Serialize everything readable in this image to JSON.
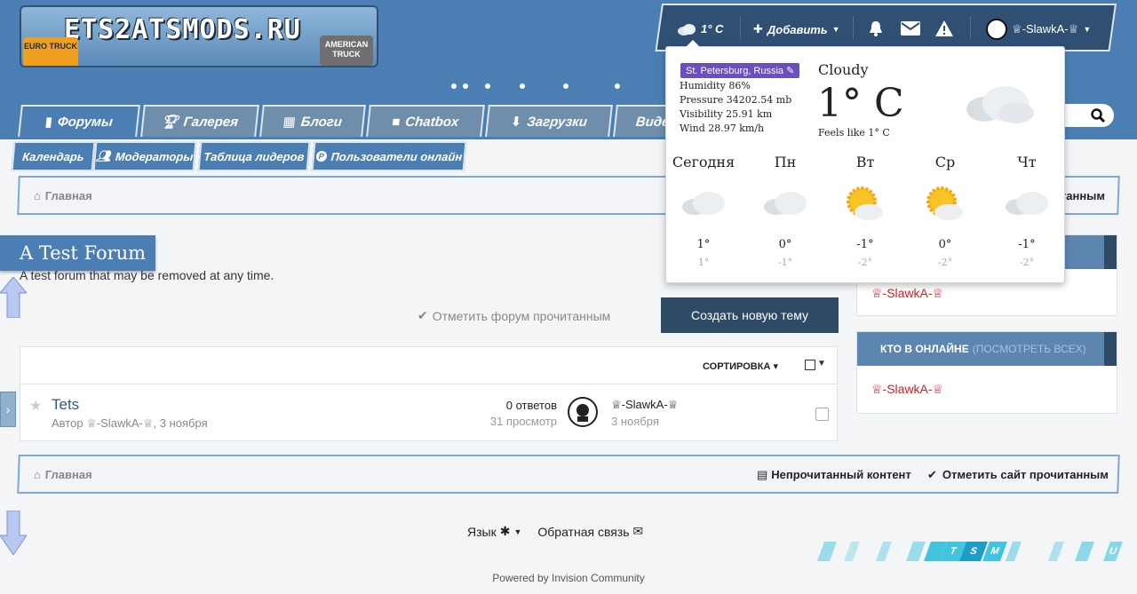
{
  "site": {
    "logo_text": "ETS2ATSMODS.RU",
    "logo_left_badge": "EURO TRUCK",
    "logo_right_badge": "AMERICAN TRUCK"
  },
  "userbar": {
    "weather_temp": "1° C",
    "add_label": "Добавить",
    "username": "♕-SlawkA-♕"
  },
  "nav": {
    "tabs": [
      {
        "label": "Форумы",
        "icon": "book-icon"
      },
      {
        "label": "Галерея",
        "icon": "trophy-icon"
      },
      {
        "label": "Блоги",
        "icon": "calendar-icon"
      },
      {
        "label": "Chatbox",
        "icon": "video-icon"
      },
      {
        "label": "Загрузки",
        "icon": "download-icon"
      },
      {
        "label": "Виде",
        "icon": ""
      }
    ],
    "subtabs": [
      {
        "label": "Календарь"
      },
      {
        "label": "Модераторы",
        "icon": "users-icon"
      },
      {
        "label": "Таблица лидеров"
      },
      {
        "label": "Пользователи онлайн",
        "icon": "online-icon"
      }
    ]
  },
  "breadcrumb": {
    "home": "Главная",
    "right_text": "танным"
  },
  "forum": {
    "title": "A Test Forum",
    "description": "A test forum that may be removed at any time.",
    "mark_read": "Отметить форум прочитанным",
    "new_topic": "Создать новую тему",
    "sort_label": "СОРТИРОВКА"
  },
  "topics": [
    {
      "title": "Tets",
      "author_prefix": "Автор",
      "author": "♕-SlawkA-♕",
      "date": "3 ноября",
      "replies": "0 ответов",
      "views": "31 просмотр",
      "last_user": "♕-SlawkA-♕",
      "last_date": "3 ноября"
    }
  ],
  "sidebar": {
    "box1_user": "♕-SlawkA-♕",
    "online_title": "КТО В ОНЛАЙНЕ",
    "online_link": "(ПОСМОТРЕТЬ ВСЕХ)",
    "online_user": "♕-SlawkA-♕"
  },
  "breadcrumb_bottom": {
    "home": "Главная",
    "unread": "Непрочитанный контент",
    "mark_site": "Отметить сайт прочитанным"
  },
  "footer": {
    "language": "Язык",
    "feedback": "Обратная связь",
    "powered": "Powered by Invision Community"
  },
  "decor": {
    "strip_letters": [
      "T",
      "S",
      "M",
      "U"
    ]
  },
  "weather": {
    "location": "St. Petersburg, Russia",
    "humidity": "Humidity 86%",
    "pressure": "Pressure 34202.54 mb",
    "visibility": "Visibility 25.91 km",
    "wind": "Wind 28.97 km/h",
    "condition": "Cloudy",
    "temp": "1° C",
    "feels": "Feels like 1° C",
    "days": [
      {
        "name": "Сегодня",
        "hi": "1°",
        "lo": "1°",
        "icon": "cloud-icon"
      },
      {
        "name": "Пн",
        "hi": "0°",
        "lo": "-1°",
        "icon": "cloud-icon"
      },
      {
        "name": "Вт",
        "hi": "-1°",
        "lo": "-2°",
        "icon": "sun-cloud-icon"
      },
      {
        "name": "Ср",
        "hi": "0°",
        "lo": "-2°",
        "icon": "sun-cloud-icon"
      },
      {
        "name": "Чт",
        "hi": "-1°",
        "lo": "-2°",
        "icon": "cloud-icon"
      }
    ]
  },
  "colors": {
    "brand_blue": "#4b7fb3",
    "dark_navy": "#2f4a66",
    "username_red": "#d0202a",
    "location_purple": "#6b4fbf"
  }
}
